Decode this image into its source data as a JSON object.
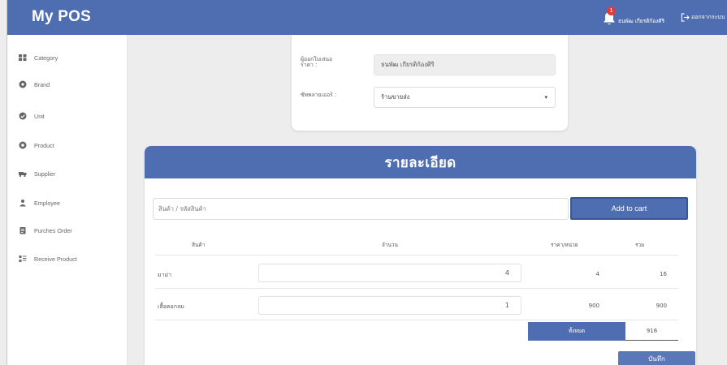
{
  "app": {
    "title": "My POS"
  },
  "header": {
    "notification_count": "1",
    "user_name": "ธนพัฒ เกียรติก้องศิริ",
    "logout_label": "ออกจากระบบ"
  },
  "sidebar": {
    "items": [
      {
        "label": "Category",
        "icon": "category-icon"
      },
      {
        "label": "Brand",
        "icon": "brand-icon"
      },
      {
        "label": "Unit",
        "icon": "unit-icon"
      },
      {
        "label": "Product",
        "icon": "product-icon"
      },
      {
        "label": "Supplier",
        "icon": "supplier-icon"
      },
      {
        "label": "Employee",
        "icon": "employee-icon"
      },
      {
        "label": "Purches Order",
        "icon": "purchase-order-icon"
      },
      {
        "label": "Receive Product",
        "icon": "receive-product-icon"
      }
    ]
  },
  "form": {
    "quote_label": "ผู้ออกใบเสนอราคา :",
    "quote_value": "ธนพัฒ เกียรติก้องศิริ",
    "supplier_label": "ซัพพลายเออร์ :",
    "supplier_value": "ร้านขายส่ง"
  },
  "detail": {
    "title": "รายละเอียด",
    "search_placeholder": "สินค้า / รหัสสินค้า",
    "add_button": "Add to cart",
    "columns": {
      "product": "สินค้า",
      "quantity": "จำนวน",
      "unit_price": "ราคา/หน่วย",
      "total": "รวม"
    },
    "rows": [
      {
        "name": "มาม่า",
        "quantity": "4",
        "unit_price": "4",
        "total": "16"
      },
      {
        "name": "เสื้อคอกลม",
        "quantity": "1",
        "unit_price": "900",
        "total": "900"
      }
    ],
    "grand_total_label": "ทั้งหมด",
    "grand_total_value": "916",
    "save_button": "บันทึก"
  },
  "colors": {
    "primary": "#4e6eb1",
    "background": "#ededed",
    "badge": "#e23b3b"
  }
}
